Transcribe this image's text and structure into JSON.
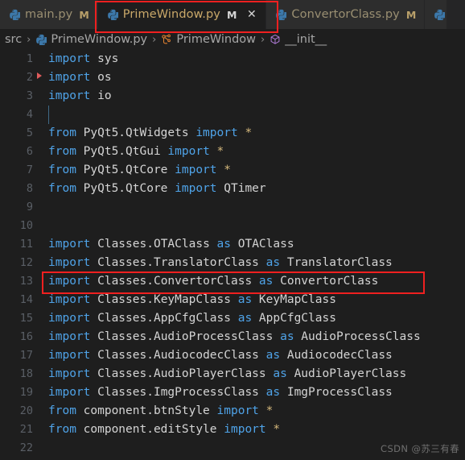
{
  "window": {
    "app": "Visual Studio Code",
    "theme_bg": "#1e1e1e",
    "accent_annotation": "#ef2020"
  },
  "tabbar": {
    "tabs": [
      {
        "label": "main.py",
        "icon": "python-file-icon",
        "dirty_badge": "M",
        "active": false,
        "has_close": false
      },
      {
        "label": "PrimeWindow.py",
        "icon": "python-file-icon",
        "dirty_badge": "M",
        "active": true,
        "has_close": true,
        "close_glyph": "✕"
      },
      {
        "label": "ConvertorClass.py",
        "icon": "python-file-icon",
        "dirty_badge": "M",
        "active": false,
        "has_close": false
      },
      {
        "label": "",
        "icon": "python-file-icon",
        "dirty_badge": "",
        "active": false,
        "has_close": false
      }
    ]
  },
  "breadcrumb": {
    "separator": "›",
    "items": [
      {
        "label": "src",
        "icon": "none"
      },
      {
        "label": "PrimeWindow.py",
        "icon": "python-file-icon"
      },
      {
        "label": "PrimeWindow",
        "icon": "class-symbol-icon"
      },
      {
        "label": "__init__",
        "icon": "method-symbol-icon"
      }
    ]
  },
  "editor": {
    "language": "python",
    "lines": [
      {
        "n": "1",
        "tokens": [
          {
            "t": "import",
            "c": "kw"
          },
          {
            "t": " sys",
            "c": "plain"
          }
        ]
      },
      {
        "n": "2",
        "breakpoint_marker": true,
        "tokens": [
          {
            "t": "import",
            "c": "kw"
          },
          {
            "t": " os",
            "c": "plain"
          }
        ]
      },
      {
        "n": "3",
        "tokens": [
          {
            "t": "import",
            "c": "kw"
          },
          {
            "t": " io",
            "c": "plain"
          }
        ]
      },
      {
        "n": "4",
        "indent_guide": true,
        "tokens": []
      },
      {
        "n": "5",
        "tokens": [
          {
            "t": "from",
            "c": "kw"
          },
          {
            "t": " PyQt5.QtWidgets ",
            "c": "plain"
          },
          {
            "t": "import",
            "c": "kw"
          },
          {
            "t": " ",
            "c": "plain"
          },
          {
            "t": "*",
            "c": "star"
          }
        ]
      },
      {
        "n": "6",
        "tokens": [
          {
            "t": "from",
            "c": "kw"
          },
          {
            "t": " PyQt5.QtGui ",
            "c": "plain"
          },
          {
            "t": "import",
            "c": "kw"
          },
          {
            "t": " ",
            "c": "plain"
          },
          {
            "t": "*",
            "c": "star"
          }
        ]
      },
      {
        "n": "7",
        "tokens": [
          {
            "t": "from",
            "c": "kw"
          },
          {
            "t": " PyQt5.QtCore ",
            "c": "plain"
          },
          {
            "t": "import",
            "c": "kw"
          },
          {
            "t": " ",
            "c": "plain"
          },
          {
            "t": "*",
            "c": "star"
          }
        ]
      },
      {
        "n": "8",
        "tokens": [
          {
            "t": "from",
            "c": "kw"
          },
          {
            "t": " PyQt5.QtCore ",
            "c": "plain"
          },
          {
            "t": "import",
            "c": "kw"
          },
          {
            "t": " QTimer",
            "c": "plain"
          }
        ]
      },
      {
        "n": "9",
        "tokens": []
      },
      {
        "n": "10",
        "tokens": []
      },
      {
        "n": "11",
        "tokens": [
          {
            "t": "import",
            "c": "kw"
          },
          {
            "t": " Classes.OTAClass ",
            "c": "plain"
          },
          {
            "t": "as",
            "c": "kw"
          },
          {
            "t": " OTAClass",
            "c": "plain"
          }
        ]
      },
      {
        "n": "12",
        "tokens": [
          {
            "t": "import",
            "c": "kw"
          },
          {
            "t": " Classes.TranslatorClass ",
            "c": "plain"
          },
          {
            "t": "as",
            "c": "kw"
          },
          {
            "t": " TranslatorClass",
            "c": "plain"
          }
        ]
      },
      {
        "n": "13",
        "highlighted": true,
        "tokens": [
          {
            "t": "import",
            "c": "kw"
          },
          {
            "t": " Classes.ConvertorClass ",
            "c": "plain"
          },
          {
            "t": "as",
            "c": "kw"
          },
          {
            "t": " ConvertorClass",
            "c": "plain"
          }
        ]
      },
      {
        "n": "14",
        "tokens": [
          {
            "t": "import",
            "c": "kw"
          },
          {
            "t": " Classes.KeyMapClass ",
            "c": "plain"
          },
          {
            "t": "as",
            "c": "kw"
          },
          {
            "t": " KeyMapClass",
            "c": "plain"
          }
        ]
      },
      {
        "n": "15",
        "tokens": [
          {
            "t": "import",
            "c": "kw"
          },
          {
            "t": " Classes.AppCfgClass ",
            "c": "plain"
          },
          {
            "t": "as",
            "c": "kw"
          },
          {
            "t": " AppCfgClass",
            "c": "plain"
          }
        ]
      },
      {
        "n": "16",
        "tokens": [
          {
            "t": "import",
            "c": "kw"
          },
          {
            "t": " Classes.AudioProcessClass ",
            "c": "plain"
          },
          {
            "t": "as",
            "c": "kw"
          },
          {
            "t": " AudioProcessClass",
            "c": "plain"
          }
        ]
      },
      {
        "n": "17",
        "tokens": [
          {
            "t": "import",
            "c": "kw"
          },
          {
            "t": " Classes.AudiocodecClass ",
            "c": "plain"
          },
          {
            "t": "as",
            "c": "kw"
          },
          {
            "t": " AudiocodecClass",
            "c": "plain"
          }
        ]
      },
      {
        "n": "18",
        "tokens": [
          {
            "t": "import",
            "c": "kw"
          },
          {
            "t": " Classes.AudioPlayerClass ",
            "c": "plain"
          },
          {
            "t": "as",
            "c": "kw"
          },
          {
            "t": " AudioPlayerClass",
            "c": "plain"
          }
        ]
      },
      {
        "n": "19",
        "tokens": [
          {
            "t": "import",
            "c": "kw"
          },
          {
            "t": " Classes.ImgProcessClass ",
            "c": "plain"
          },
          {
            "t": "as",
            "c": "kw"
          },
          {
            "t": " ImgProcessClass",
            "c": "plain"
          }
        ]
      },
      {
        "n": "20",
        "tokens": [
          {
            "t": "from",
            "c": "kw"
          },
          {
            "t": " component.btnStyle ",
            "c": "plain"
          },
          {
            "t": "import",
            "c": "kw"
          },
          {
            "t": " ",
            "c": "plain"
          },
          {
            "t": "*",
            "c": "star"
          }
        ]
      },
      {
        "n": "21",
        "tokens": [
          {
            "t": "from",
            "c": "kw"
          },
          {
            "t": " component.editStyle ",
            "c": "plain"
          },
          {
            "t": "import",
            "c": "kw"
          },
          {
            "t": " ",
            "c": "plain"
          },
          {
            "t": "*",
            "c": "star"
          }
        ]
      },
      {
        "n": "22",
        "tokens": []
      }
    ]
  },
  "watermark": {
    "text": "CSDN @苏三有春"
  }
}
